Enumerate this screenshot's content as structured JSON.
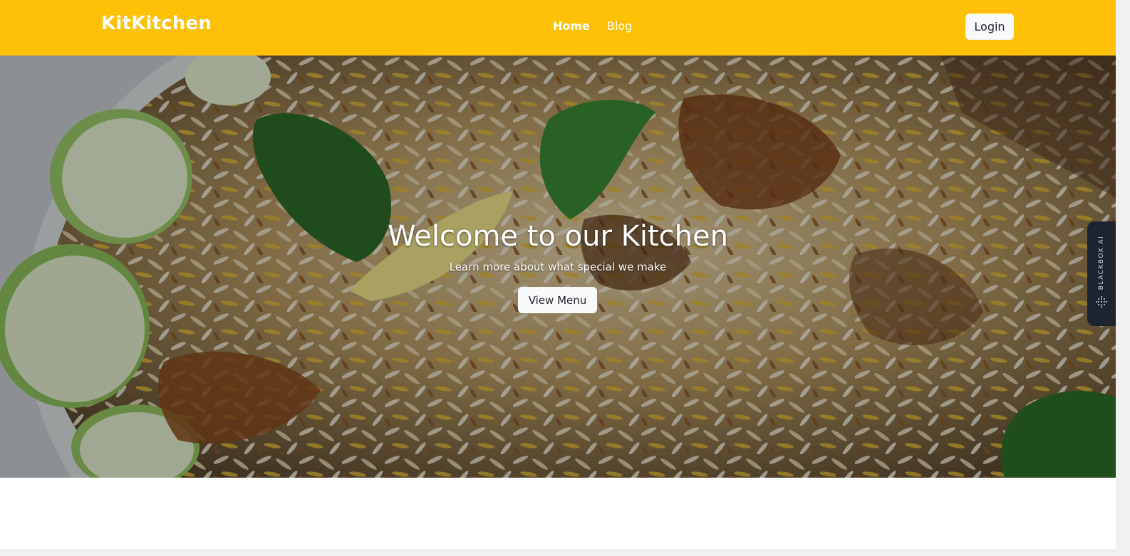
{
  "navbar": {
    "brand": "KitKitchen",
    "links": [
      {
        "label": "Home",
        "active": true
      },
      {
        "label": "Blog",
        "active": false
      }
    ],
    "login_label": "Login",
    "background": "#ffc107"
  },
  "hero": {
    "title": "Welcome to our Kitchen",
    "subtitle": "Learn more about what special we make",
    "button_label": "View Menu"
  },
  "blackbox_tab": {
    "label": "BLACKBOX AI",
    "background": "#1c2430"
  }
}
